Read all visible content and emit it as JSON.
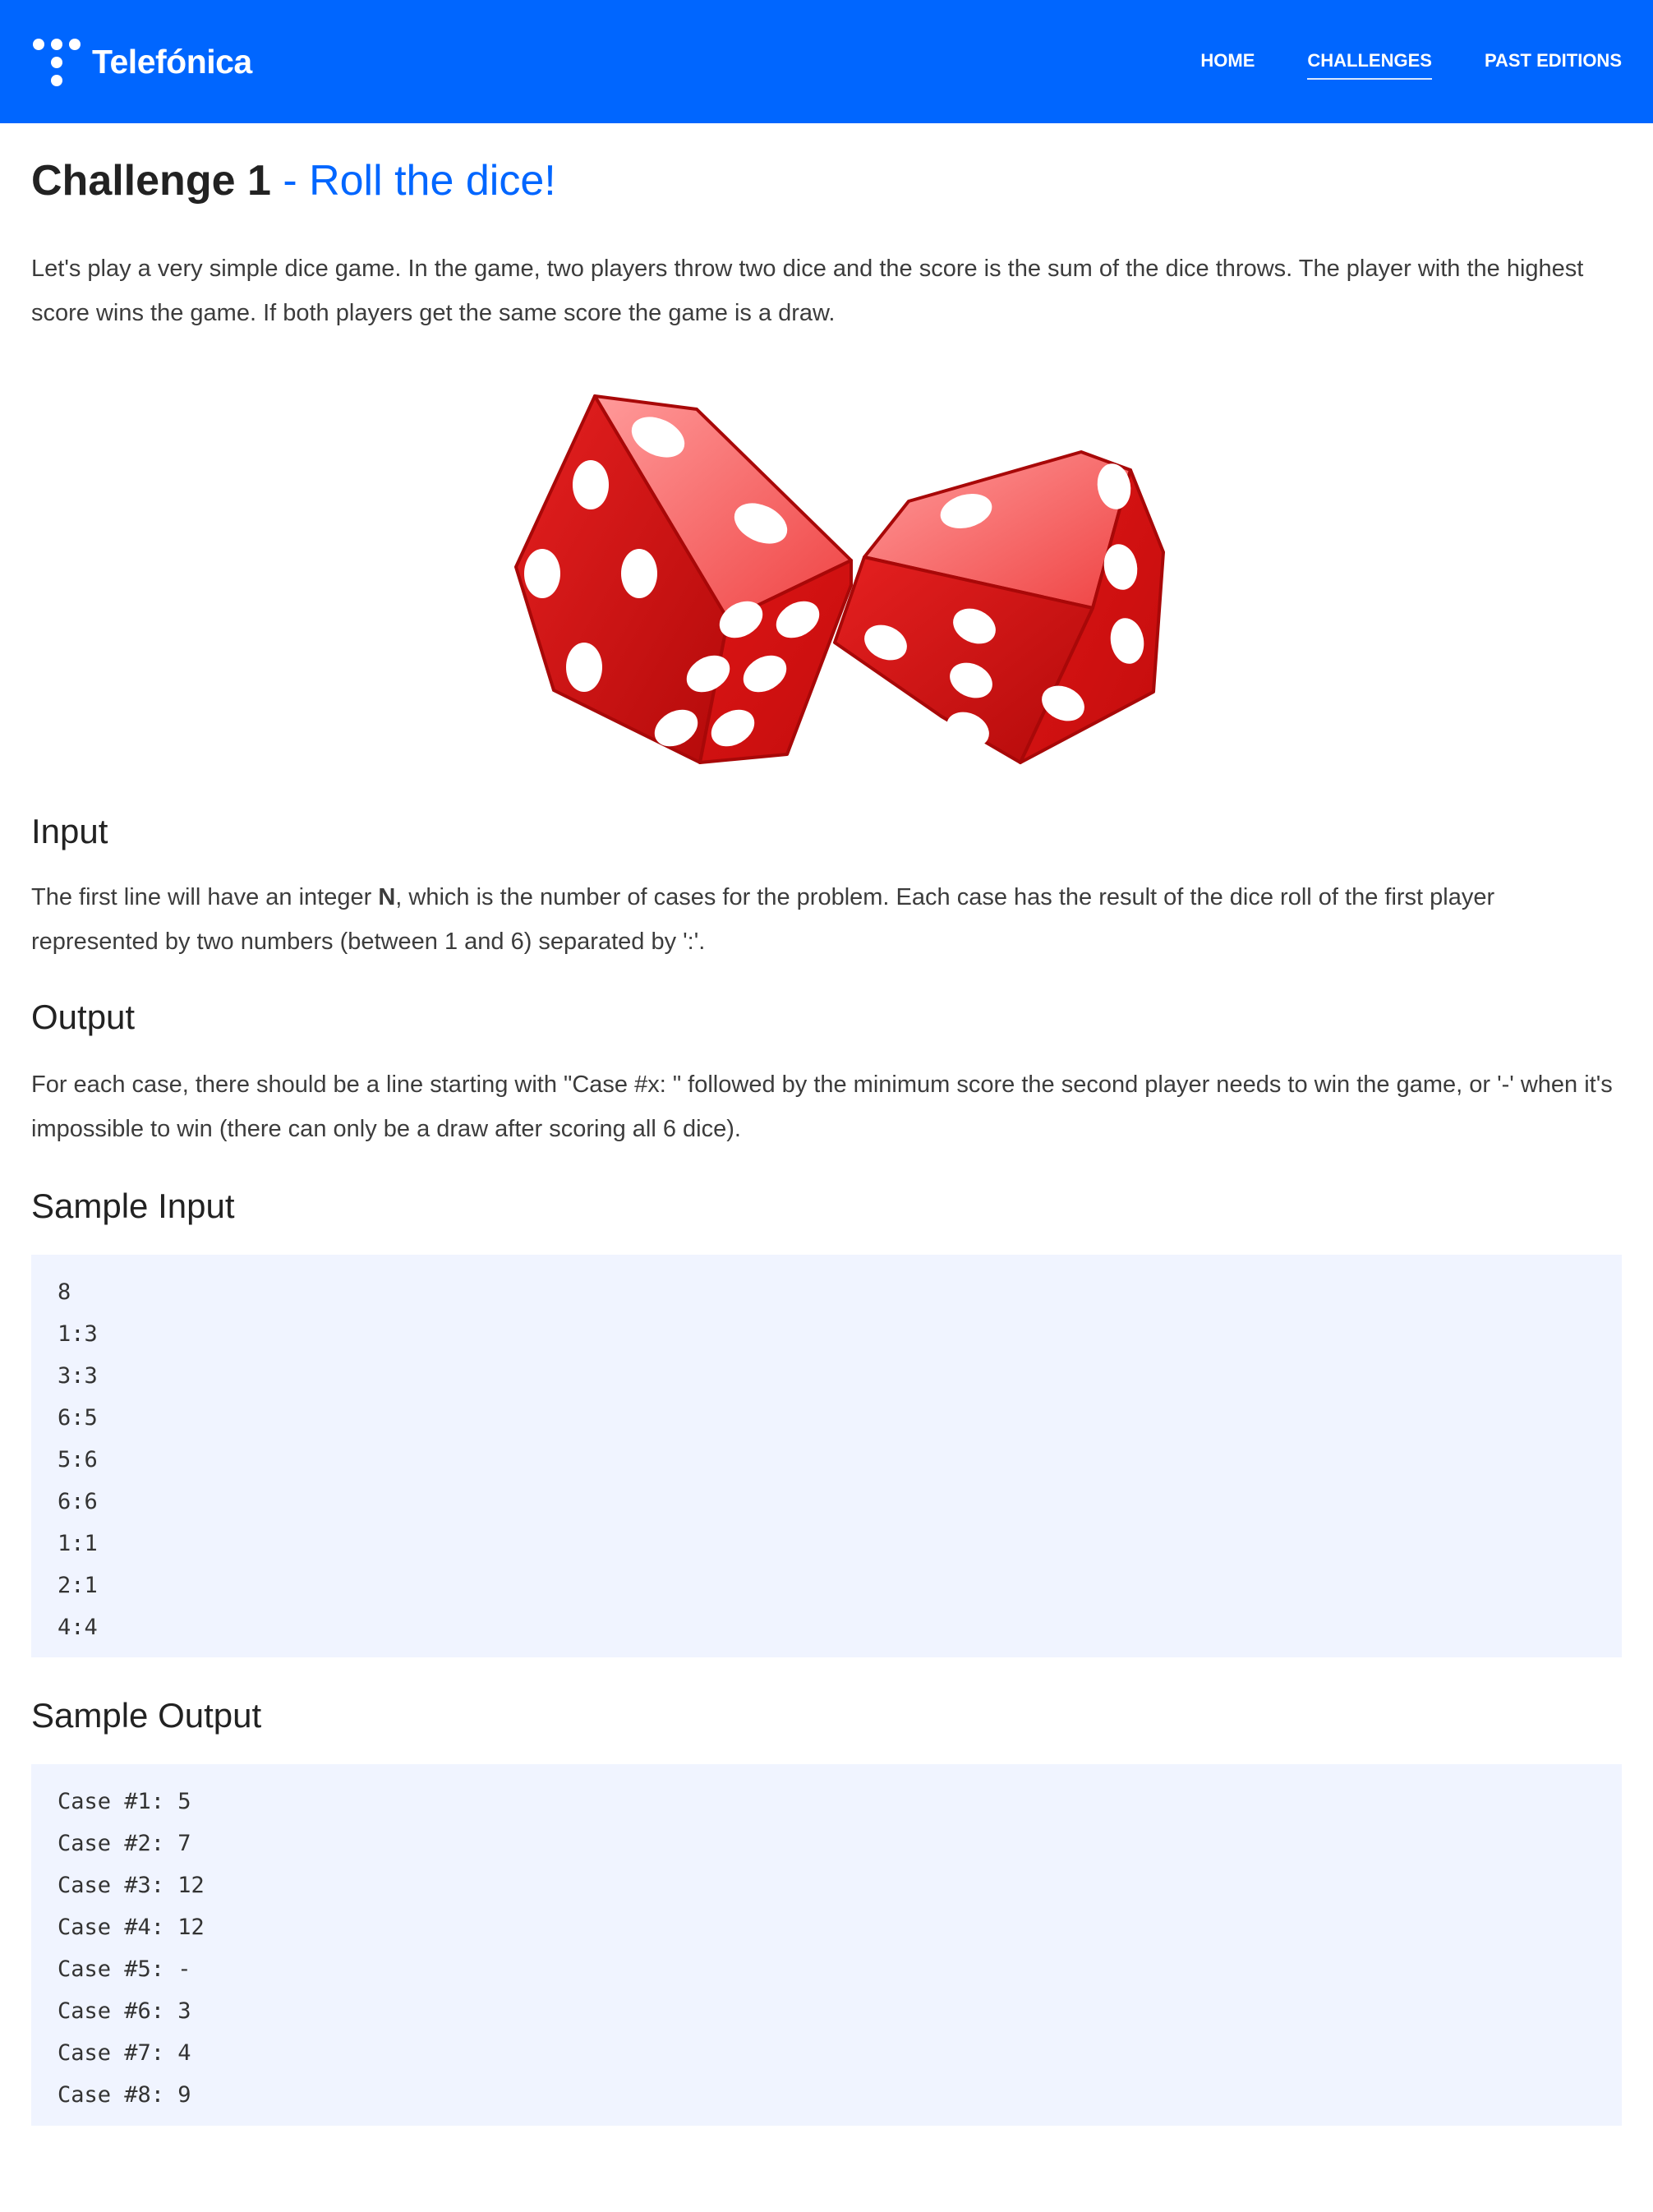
{
  "header": {
    "brand": "Telefónica",
    "nav": [
      {
        "label": "HOME"
      },
      {
        "label": "CHALLENGES"
      },
      {
        "label": "PAST EDITIONS"
      }
    ],
    "active_nav": "CHALLENGES",
    "background_color": "#0066ff"
  },
  "challenge": {
    "title": "Challenge 1",
    "subtitle": " - Roll the dice!",
    "intro": "Let's play a very simple dice game. In the game, two players throw two dice and the score is the sum of the dice throws. The player with the highest score wins the game. If both players get the same score the game is a draw.",
    "image_icon": "two-red-dice-icon",
    "input": {
      "heading": "Input",
      "text_before": "The first line will have an integer ",
      "text_bold": "N",
      "text_after": ", which is the number of cases for the problem. Each case has the result of the dice roll of the first player represented by two numbers (between 1 and 6) separated by ':'."
    },
    "output": {
      "heading": "Output",
      "text": "For each case, there should be a line starting with \"Case #x: \" followed by the minimum score the second player needs to win the game, or '-' when it's impossible to win (there can only be a draw after scoring all 6 dice)."
    },
    "sample_input": {
      "heading": "Sample Input",
      "lines": [
        "8",
        "1:3",
        "3:3",
        "6:5",
        "5:6",
        "6:6",
        "1:1",
        "2:1",
        "4:4"
      ]
    },
    "sample_output": {
      "heading": "Sample Output",
      "lines": [
        "Case #1: 5",
        "Case #2: 7",
        "Case #3: 12",
        "Case #4: 12",
        "Case #5: -",
        "Case #6: 3",
        "Case #7: 4",
        "Case #8: 9"
      ]
    }
  },
  "colors": {
    "accent": "#0066ff",
    "code_background": "#f0f4ff",
    "dice_red": "#e41b1b"
  }
}
